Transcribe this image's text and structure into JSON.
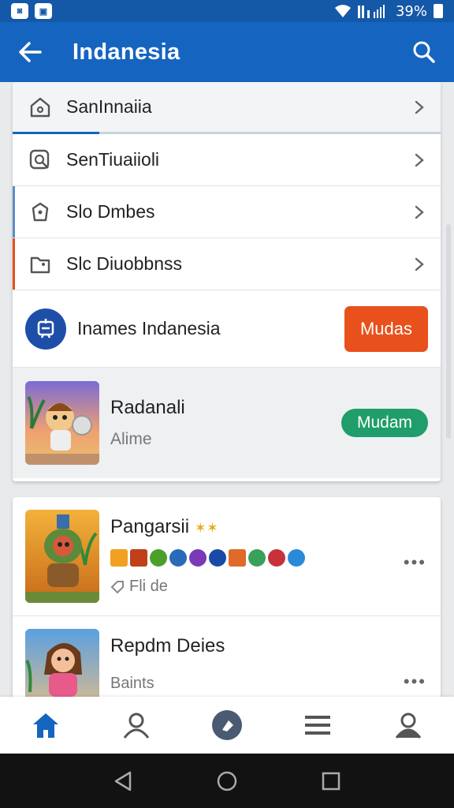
{
  "status_bar": {
    "battery_text": "39%",
    "left_icons": [
      "notification-icon",
      "photo-icon"
    ],
    "right_icons": [
      "wifi-icon",
      "signal-icon"
    ]
  },
  "app_bar": {
    "title": "Indanesia"
  },
  "menu": {
    "items": [
      {
        "label": "SanInnaiia",
        "icon": "home-icon"
      },
      {
        "label": "SenTiuaiioli",
        "icon": "search-icon"
      },
      {
        "label": "Slo Dmbes",
        "icon": "tag-icon"
      },
      {
        "label": "Slc Diuobbnss",
        "icon": "folder-icon"
      }
    ]
  },
  "promo": {
    "text": "Inames Indanesia",
    "button_label": "Mudas"
  },
  "featured": {
    "name": "Radanali",
    "subtitle": "Alime",
    "button_label": "Mudam"
  },
  "list": {
    "items": [
      {
        "name": "Pangarsii",
        "subtitle": "Fli de"
      },
      {
        "name": "Repdm Deies",
        "subtitle": "Baints"
      }
    ]
  },
  "colors": {
    "primary": "#1565c0",
    "orange": "#e8501c",
    "green": "#1f9d6a"
  }
}
